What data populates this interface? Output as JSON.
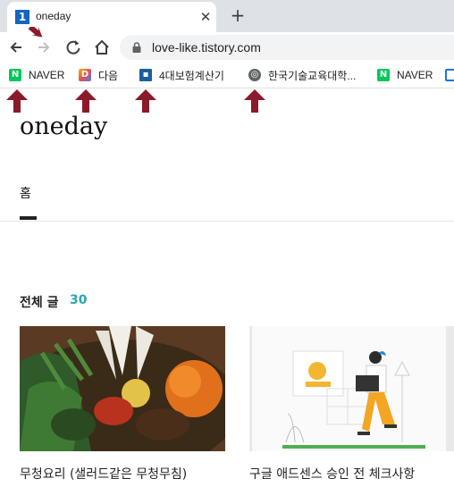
{
  "browser": {
    "tab": {
      "favicon": "1",
      "title": "oneday"
    },
    "url": "love-like.tistory.com",
    "bookmarks": [
      {
        "label": "NAVER",
        "icon": "naver-icon"
      },
      {
        "label": "다음",
        "icon": "daum-icon"
      },
      {
        "label": "4대보험계산기",
        "icon": "calculator-icon"
      },
      {
        "label": "한국기술교육대학...",
        "icon": "globe-icon"
      },
      {
        "label": "NAVER",
        "icon": "naver-icon"
      }
    ]
  },
  "blog": {
    "title": "oneday",
    "menu": {
      "home": "홈"
    },
    "section": {
      "heading": "전체 글",
      "count": "30"
    },
    "posts": [
      {
        "title": "무청요리 (샐러드같은 무청무침)"
      },
      {
        "title": "구글 애드센스 승인 전 체크사항"
      }
    ]
  },
  "colors": {
    "accent": "#2aa6b5",
    "arrow": "#8b1a2b",
    "naver": "#03c75a"
  }
}
